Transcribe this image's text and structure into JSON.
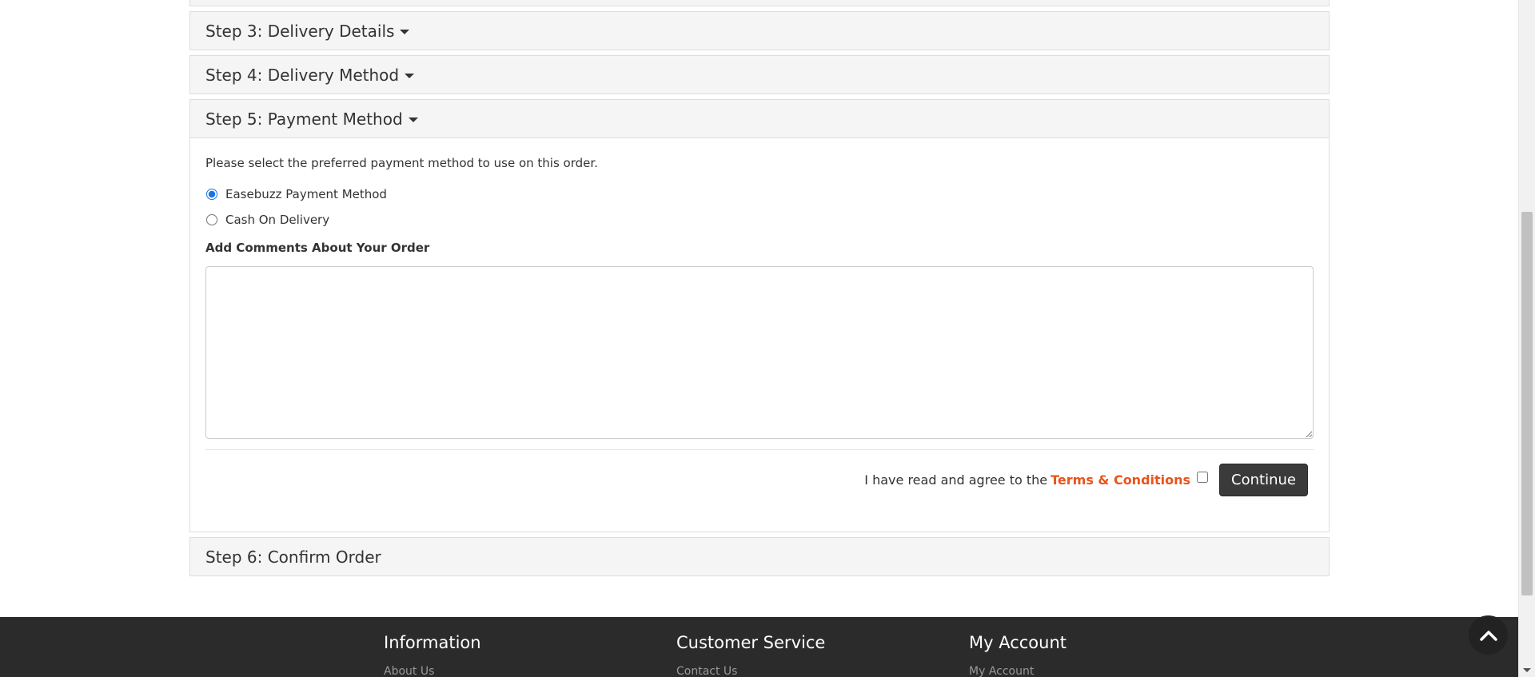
{
  "checkout": {
    "step3": {
      "title": "Step 3: Delivery Details"
    },
    "step4": {
      "title": "Step 4: Delivery Method"
    },
    "step5": {
      "title": "Step 5: Payment Method",
      "intro": "Please select the preferred payment method to use on this order.",
      "payment_options": [
        {
          "label": "Easebuzz Payment Method",
          "selected": true
        },
        {
          "label": "Cash On Delivery",
          "selected": false
        }
      ],
      "comments_label": "Add Comments About Your Order",
      "comments_value": "",
      "agree_text": "I have read and agree to the",
      "terms_link": "Terms & Conditions",
      "continue_label": "Continue"
    },
    "step6": {
      "title": "Step 6: Confirm Order"
    }
  },
  "footer": {
    "information": {
      "heading": "Information",
      "first_link": "About Us"
    },
    "customer_service": {
      "heading": "Customer Service",
      "first_link": "Contact Us"
    },
    "my_account": {
      "heading": "My Account",
      "first_link": "My Account"
    }
  },
  "icons": {
    "scroll_top": "chevron-up-icon",
    "caret": "caret-down-icon"
  },
  "colors": {
    "accent": "#e8541a",
    "footer_bg": "#2b2b2b",
    "button_bg": "#3a3a3a"
  }
}
